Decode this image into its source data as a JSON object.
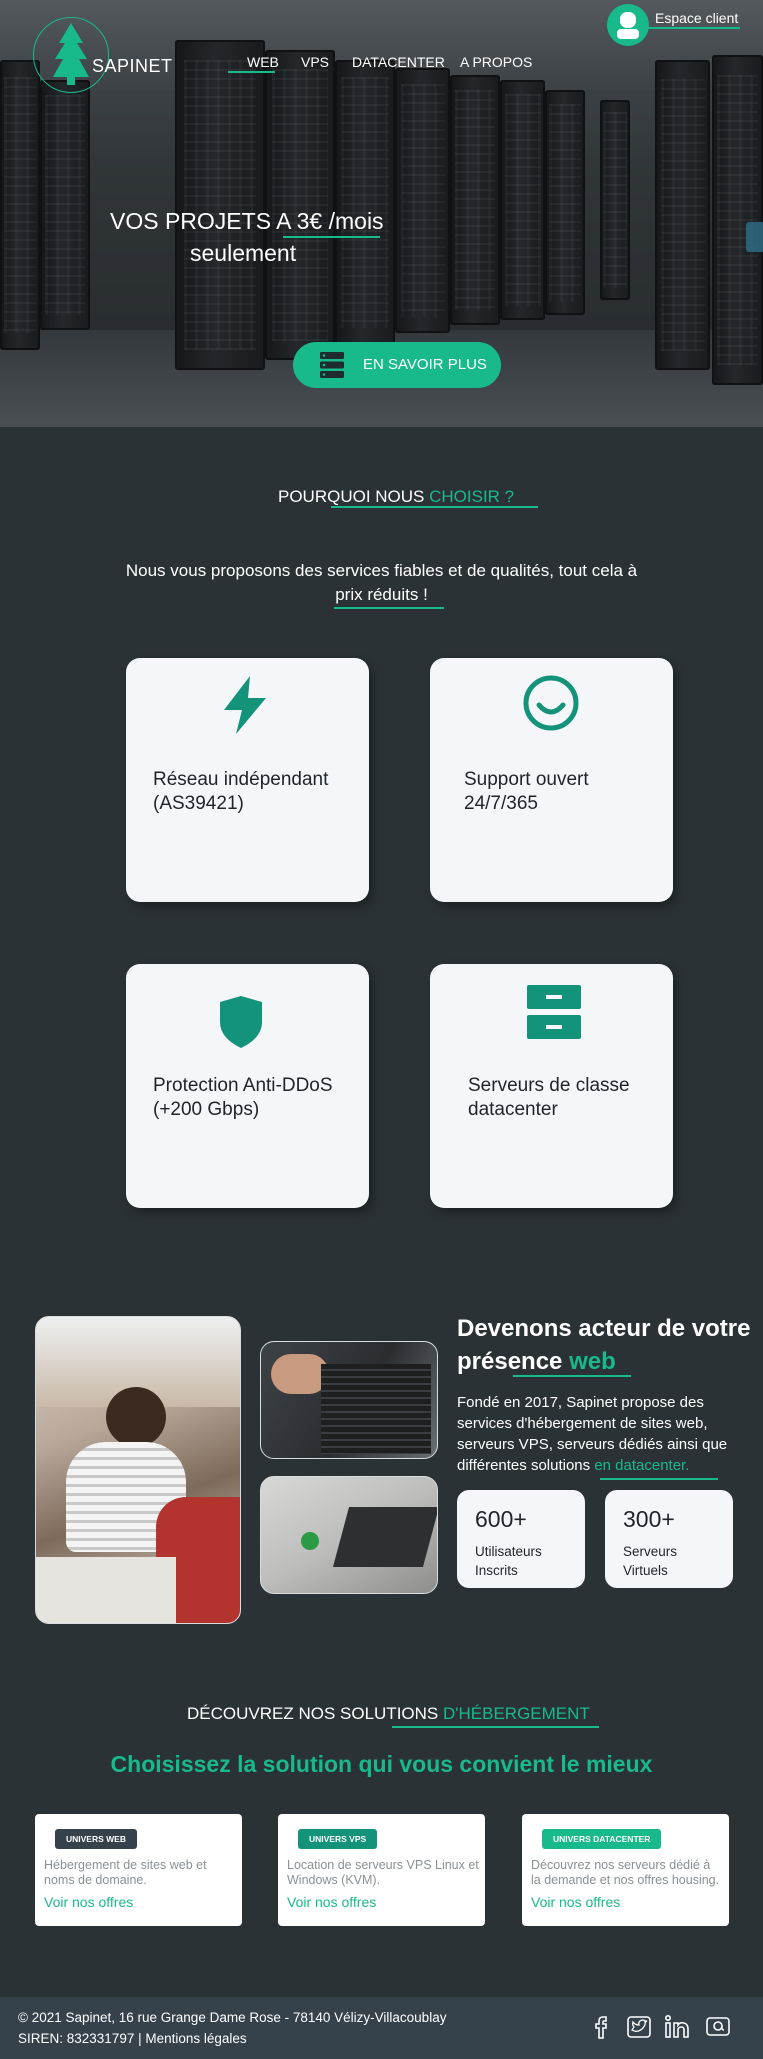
{
  "brand": {
    "name": "SAPINET",
    "accent_color": "#18b98a",
    "bg_color": "#2b3236"
  },
  "nav": {
    "items": [
      {
        "label": "WEB",
        "active": true
      },
      {
        "label": "VPS"
      },
      {
        "label": "DATACENTER"
      },
      {
        "label": "A PROPOS"
      }
    ],
    "client_label": "Espace client",
    "client_icon": "user-icon"
  },
  "hero": {
    "title_prefix": "VOS PROJETS A ",
    "title_accent": "3€",
    "title_suffix": " /mois",
    "title_line2": "seulement",
    "cta_label": "EN SAVOIR PLUS",
    "cta_icon": "server-stack-icon"
  },
  "why": {
    "heading_prefix": "POURQUOI NOUS ",
    "heading_accent": "CHOISIR ?",
    "intro_line1": "Nous vous proposons des services fiables et de qualités, tout cela à",
    "intro_accent": "prix réduits !",
    "cards": [
      {
        "icon": "lightning-icon",
        "line1": "Réseau indépendant",
        "line2": "(AS39421)"
      },
      {
        "icon": "smiley-icon",
        "line1": "Support ouvert",
        "line2": "24/7/365"
      },
      {
        "icon": "shield-icon",
        "line1": "Protection Anti-DDoS",
        "line2": "(+200 Gbps)"
      },
      {
        "icon": "server-icon",
        "line1": "Serveurs de classe",
        "line2": "datacenter"
      }
    ]
  },
  "about": {
    "title_line1": "Devenons acteur de votre",
    "title_line2_prefix": "présence ",
    "title_line2_accent": "web",
    "text": "Fondé en 2017, Sapinet propose des services d'hébergement de sites web, serveurs VPS, serveurs dédiés ainsi que différentes solutions ",
    "text_accent": "en datacenter.",
    "stats": [
      {
        "value": "600+",
        "label1": "Utilisateurs",
        "label2": "Inscrits"
      },
      {
        "value": "300+",
        "label1": "Serveurs",
        "label2": "Virtuels"
      }
    ]
  },
  "solutions": {
    "heading_prefix": "DÉCOUVREZ NOS SOLUTIONS ",
    "heading_accent": "D'HÉBERGEMENT",
    "subheading": "Choisissez la solution qui vous convient le mieux",
    "offers": [
      {
        "badge": "UNIVERS WEB",
        "badge_color": "#35424c",
        "desc": "Hébergement de sites web et noms de domaine.",
        "link": "Voir nos offres"
      },
      {
        "badge": "UNIVERS VPS",
        "badge_color": "#13937a",
        "desc": "Location de serveurs VPS Linux et Windows (KVM).",
        "link": "Voir nos offres"
      },
      {
        "badge": "UNIVERS DATACENTER",
        "badge_color": "#18b98a",
        "desc": "Découvrez nos serveurs dédié à la demande et nos offres housing.",
        "link": "Voir nos offres"
      }
    ]
  },
  "footer": {
    "line1": "© 2021 Sapinet, 16 rue Grange Dame Rose - 78140 Vélizy-Villacoublay",
    "line2": "SIREN: 832331797 | Mentions légales",
    "social": [
      "facebook-icon",
      "twitter-icon",
      "linkedin-icon",
      "email-icon"
    ]
  }
}
